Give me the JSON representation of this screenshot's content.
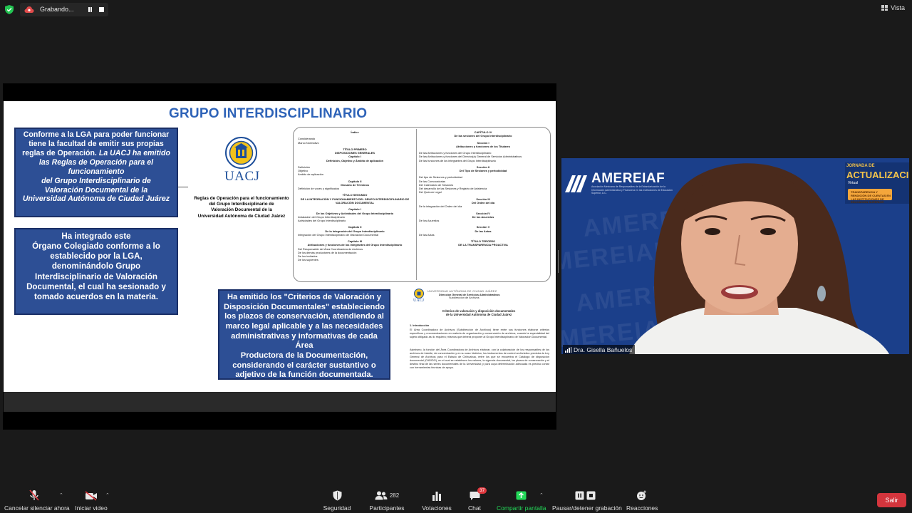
{
  "top_bar": {
    "recording_label": "Grabando...",
    "view_label": "Vista"
  },
  "slide": {
    "title": "GRUPO INTERDISCIPLINARIO",
    "box1": {
      "line1": "Conforme a la LGA para poder funcionar",
      "line2": "tiene la facultad de emitir sus propias",
      "line3": "reglas de Operación.",
      "line3_italic": "La UACJ ha emitido",
      "line4": "las Reglas de Operación para el",
      "line5": "funcionamiento",
      "line6": "del Grupo Interdisciplinario de",
      "line7": "Valoración Documental de la",
      "line8": "Universidad Autónoma de Ciudad Juárez"
    },
    "box2": {
      "line1": "Ha integrado este",
      "line2": "Órgano Colegiado conforme a lo",
      "line3": "establecido por la LGA,",
      "line4": "denominándolo Grupo",
      "line5": "Interdisciplinario de Valoración",
      "line6": "Documental, el cual ha sesionado y",
      "line7": "tomado acuerdos en la materia."
    },
    "box3": {
      "line1": "Ha emitido los \"Criterios de Valoración y",
      "line2": "Disposición Documentales\" estableciendo",
      "line3": "los plazos de conservación, atendiendo al",
      "line4": "marco legal aplicable y a las necesidades",
      "line5": "administrativas y informativas de cada Área",
      "line6": "Productora de la Documentación,",
      "line7": "considerando el carácter sustantivo o",
      "line8": "adjetivo de la función documentada."
    },
    "uacj_logo_text": "UACJ",
    "rules_caption": {
      "line1": "Reglas de Operación para el funcionamiento",
      "line2": "del Grupo Interdisciplinario de",
      "line3": "Valoración Documental de la",
      "line4": "Universidad Autónoma de Ciudad Juárez"
    },
    "index_doc": {
      "left": [
        {
          "t": "Índice",
          "c": true
        },
        {
          "t": ""
        },
        {
          "t": "Considerando"
        },
        {
          "t": "Marco Normativo"
        },
        {
          "t": ""
        },
        {
          "t": "TÍTULO PRIMERO",
          "c": true
        },
        {
          "t": "DISPOSICIONES GENERALES",
          "c": true
        },
        {
          "t": "Capítulo I",
          "c": true
        },
        {
          "t": "Definición, Objetivo y Ámbito de aplicación",
          "c": true
        },
        {
          "t": ""
        },
        {
          "t": "Definición"
        },
        {
          "t": "Objetivo"
        },
        {
          "t": "Ámbito de aplicación"
        },
        {
          "t": ""
        },
        {
          "t": "Capítulo II",
          "c": true
        },
        {
          "t": "Glosario de Términos",
          "c": true
        },
        {
          "t": "Definición de voces y significados"
        },
        {
          "t": ""
        },
        {
          "t": "TÍTULO SEGUNDO",
          "c": true
        },
        {
          "t": "DE LA INTEGRACIÓN Y FUNCIONAMIENTO DEL GRUPO INTERDISCIPLINARIO DE",
          "c": true
        },
        {
          "t": "VALORACIÓN DOCUMENTAL",
          "c": true
        },
        {
          "t": ""
        },
        {
          "t": "Capítulo I",
          "c": true
        },
        {
          "t": "De los Objetivos y Actividades del Grupo Interdisciplinario",
          "c": true
        },
        {
          "t": "Instalación del Grupo Interdisciplinario"
        },
        {
          "t": "Actividades del Grupo Interdisciplinario"
        },
        {
          "t": ""
        },
        {
          "t": "Capítulo II",
          "c": true
        },
        {
          "t": "De la Integración del Grupo Interdisciplinario",
          "c": true
        },
        {
          "t": "Integración del Grupo Interdisciplinario de Valoración Documental"
        },
        {
          "t": ""
        },
        {
          "t": "Capítulo III",
          "c": true
        },
        {
          "t": "Atribuciones y funciones de los integrantes del Grupo Interdisciplinario",
          "c": true
        },
        {
          "t": "Del Responsable del Área Coordinadora de Archivos"
        },
        {
          "t": "De los demás productores de la documentación"
        },
        {
          "t": "De los invitados"
        },
        {
          "t": "De los suplentes"
        }
      ],
      "right": [
        {
          "t": "CAPÍTULO IV",
          "c": true
        },
        {
          "t": "De las sesiones del Grupo Interdisciplinario",
          "c": true
        },
        {
          "t": ""
        },
        {
          "t": "Sección I",
          "c": true
        },
        {
          "t": "Atribuciones y funciones de los Titulares",
          "c": true
        },
        {
          "t": ""
        },
        {
          "t": "De las Atribuciones y funciones del Grupo Interdisciplinario"
        },
        {
          "t": "De las Atribuciones y funciones del Director(a) General de Servicios Administrativos"
        },
        {
          "t": "De las funciones de los integrantes del Grupo Interdisciplinario"
        },
        {
          "t": ""
        },
        {
          "t": "Sección II",
          "c": true
        },
        {
          "t": "Del Tipo de Sesiones y periodicidad",
          "c": true
        },
        {
          "t": ""
        },
        {
          "t": "Del tipo de Sesiones y periodicidad"
        },
        {
          "t": "De las Convocatorias"
        },
        {
          "t": "Del Calendario de Sesiones"
        },
        {
          "t": "Del desarrollo de las Sesiones y Registro de Asistencia"
        },
        {
          "t": "Del Quórum Legal"
        },
        {
          "t": ""
        },
        {
          "t": "Sección III",
          "c": true
        },
        {
          "t": "Del Orden del día",
          "c": true
        },
        {
          "t": "De la integración del Orden del día"
        },
        {
          "t": ""
        },
        {
          "t": "Sección IV",
          "c": true
        },
        {
          "t": "De los Acuerdos",
          "c": true
        },
        {
          "t": "De los Acuerdos"
        },
        {
          "t": ""
        },
        {
          "t": "Sección V",
          "c": true
        },
        {
          "t": "De las Actas",
          "c": true
        },
        {
          "t": "De las Actas"
        },
        {
          "t": ""
        },
        {
          "t": "TÍTULO TERCERO",
          "c": true
        },
        {
          "t": "DE LA TRANSPARENCIA PROACTIVA",
          "c": true
        }
      ]
    },
    "criteria_doc": {
      "header1": "UNIVERSIDAD AUTÓNOMA DE CIUDAD JUÁREZ",
      "header2": "Dirección General de Servicios Administrativos",
      "header3": "Subdirección de Archivos",
      "mini_logo": "UACJ",
      "title1": "Criterios de valoración y disposición documentales",
      "title2": "de la Universidad Autónoma de Ciudad Juárez",
      "intro_heading": "1. Introducción",
      "para1": "El Área Coordinadora de Archivos (Subdirección de Archivos) tiene entre sus funciones elaborar criterios específicos y recomendaciones en materia de organización y conservación de archivos, cuando la especialidad del sujeto obligado así lo requiera; mismos que deberá proponer al Grupo Interdisciplinario de Valoración Documental.",
      "para2": "Asimismo, la función del Área Coordinadora de Archivos elaborar, con la colaboración de los responsables de los archivos de trámite, de concentración y en su caso histórico, los instrumentos de control archivístico previstos la Ley General de Archivos para el Estado de Chihuahua, entre los que se encuentra el Catálogo de disposición documental (CADIDO), en el cual se establecen los valores, la vigencia documental, los plazos de conservación y el destino final de las series documentales de la Universidad; y para cuya determinación adecuada es preciso contar con herramientas técnicas de apoyo."
    }
  },
  "video": {
    "participant_name": "Dra. Gisella Bañuelos",
    "backdrop_logo": "AMEREIAF",
    "backdrop_logo_sub": "Asociación Mexicana de Responsables de la Estandarización de la Información Administrativa y Financiera en las Instituciones de Educación Superior, A.C.",
    "banner_line1": "JORNADA DE",
    "banner_line2": "ACTUALIZACIÓN",
    "banner_line3": "Virtual",
    "banner_strip": "TRANSPARENCIA Y RENDICIÓN DE CUENTAS EN LAS INSTITUCIONES DE EDUCACIÓN SUPERIOR",
    "watermark": "AMEREIAF"
  },
  "toolbar": {
    "mute_label": "Cancelar silenciar ahora",
    "video_label": "Iniciar video",
    "security_label": "Seguridad",
    "participants_label": "Participantes",
    "participants_count": "282",
    "polls_label": "Votaciones",
    "chat_label": "Chat",
    "chat_badge": "37",
    "share_label": "Compartir pantalla",
    "record_label": "Pausar/detener grabación",
    "reactions_label": "Reacciones",
    "leave_label": "Salir"
  },
  "colors": {
    "share_green": "#23d959",
    "leave_red": "#d4353d",
    "slide_title_blue": "#2e63b8",
    "box_blue": "#2d4f95"
  }
}
